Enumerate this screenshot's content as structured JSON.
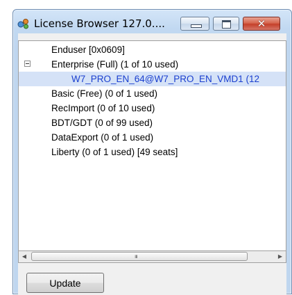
{
  "window": {
    "title": "License Browser 127.0...."
  },
  "caption_buttons": {
    "minimize_icon": "minimize-icon",
    "maximize_icon": "maximize-icon",
    "close_icon": "close-icon",
    "close_glyph": "✕"
  },
  "tree": {
    "items": [
      {
        "label": "Enduser [0x0609]",
        "expander": false,
        "selected": false
      },
      {
        "label": "Enterprise (Full) (1 of 10 used)",
        "expander": true,
        "state": "expanded",
        "selected": false
      },
      {
        "label": "W7_PRO_EN_64@W7_PRO_EN_VMD1 (12",
        "expander": false,
        "selected": true,
        "child": true
      },
      {
        "label": "Basic (Free) (0 of 1 used)",
        "expander": false,
        "selected": false
      },
      {
        "label": "RecImport (0 of 10 used)",
        "expander": false,
        "selected": false
      },
      {
        "label": "BDT/GDT (0 of 99 used)",
        "expander": false,
        "selected": false
      },
      {
        "label": "DataExport (0 of 1 used)",
        "expander": false,
        "selected": false
      },
      {
        "label": "Liberty (0 of 1 used) [49 seats]",
        "expander": false,
        "selected": false
      }
    ]
  },
  "scrollbar": {
    "left_arrow": "◀",
    "right_arrow": "▶",
    "grip": "ııı"
  },
  "footer": {
    "update_label": "Update"
  },
  "colors": {
    "selection": "#d5e2f7",
    "selected_text": "#1a3fcf",
    "close_button": "#c5402a"
  }
}
